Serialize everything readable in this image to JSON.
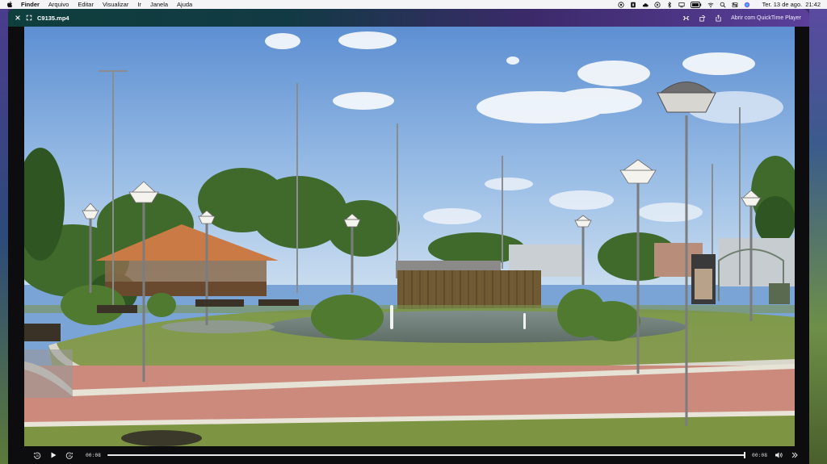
{
  "menubar": {
    "items": [
      "Finder",
      "Arquivo",
      "Editar",
      "Visualizar",
      "Ir",
      "Janela",
      "Ajuda"
    ],
    "date": "Ter. 13 de ago.",
    "time": "21:42",
    "status_icons": [
      "vpn-icon",
      "shield-icon",
      "cloud-icon",
      "play-circle-icon",
      "bluetooth-icon",
      "screen-mirror-icon",
      "battery-icon",
      "wifi-icon",
      "search-icon",
      "control-center-icon",
      "siri-icon"
    ]
  },
  "window": {
    "title": "C9135.mp4",
    "open_with": "Abrir com QuickTime Player",
    "accent_start": "#0f3f3d",
    "accent_end": "#5b3f9a"
  },
  "player": {
    "current_time": "00:08",
    "duration": "00:08",
    "progress": 1.0
  }
}
